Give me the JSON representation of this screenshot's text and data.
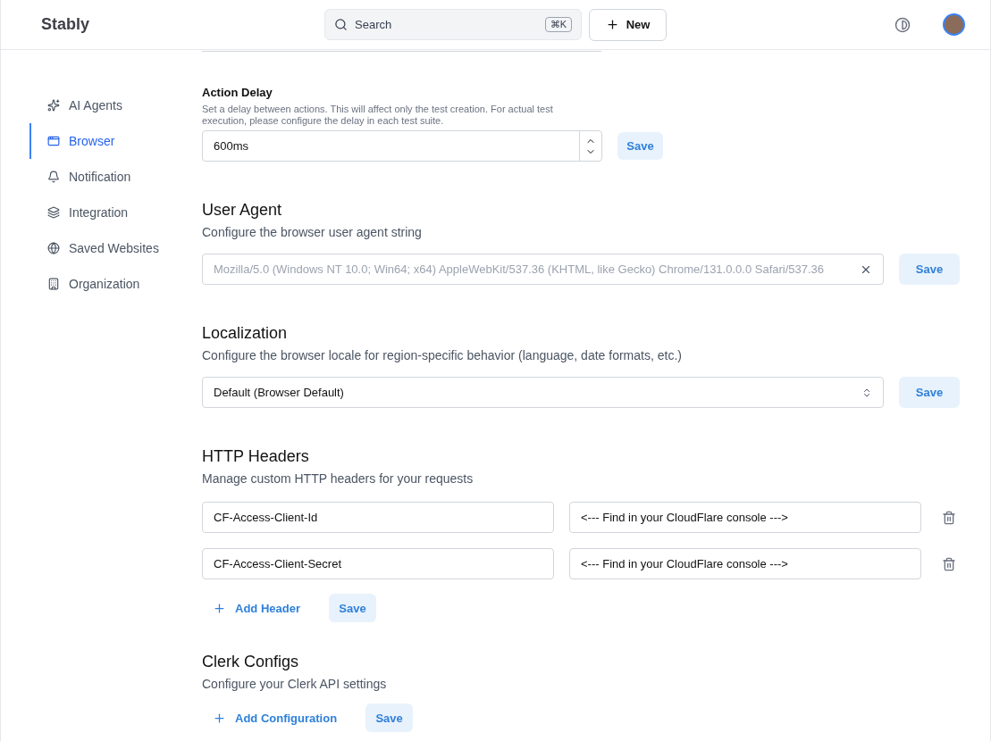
{
  "header": {
    "brand": "Stably",
    "search": {
      "placeholder": "Search",
      "shortcut": "⌘K"
    },
    "new_button": "New"
  },
  "sidebar": {
    "items": [
      {
        "label": "AI Agents",
        "selected": false
      },
      {
        "label": "Browser",
        "selected": true
      },
      {
        "label": "Notification",
        "selected": false
      },
      {
        "label": "Integration",
        "selected": false
      },
      {
        "label": "Saved Websites",
        "selected": false
      },
      {
        "label": "Organization",
        "selected": false
      }
    ]
  },
  "action_delay": {
    "label": "Action Delay",
    "description": "Set a delay between actions. This will affect only the test creation. For actual test execution, please configure the delay in each test suite.",
    "value": "600ms",
    "save": "Save"
  },
  "user_agent": {
    "title": "User Agent",
    "description": "Configure the browser user agent string",
    "placeholder": "Mozilla/5.0 (Windows NT 10.0; Win64; x64) AppleWebKit/537.36 (KHTML, like Gecko) Chrome/131.0.0.0 Safari/537.36",
    "save": "Save"
  },
  "localization": {
    "title": "Localization",
    "description": "Configure the browser locale for region-specific behavior (language, date formats, etc.)",
    "value": "Default (Browser Default)",
    "save": "Save"
  },
  "http_headers": {
    "title": "HTTP Headers",
    "description": "Manage custom HTTP headers for your requests",
    "rows": [
      {
        "name": "CF-Access-Client-Id",
        "value": "<--- Find in your CloudFlare console --->"
      },
      {
        "name": "CF-Access-Client-Secret",
        "value": "<--- Find in your CloudFlare console --->"
      }
    ],
    "add": "Add Header",
    "save": "Save"
  },
  "clerk_configs": {
    "title": "Clerk Configs",
    "description": "Configure your Clerk API settings",
    "add": "Add Configuration",
    "save": "Save"
  }
}
